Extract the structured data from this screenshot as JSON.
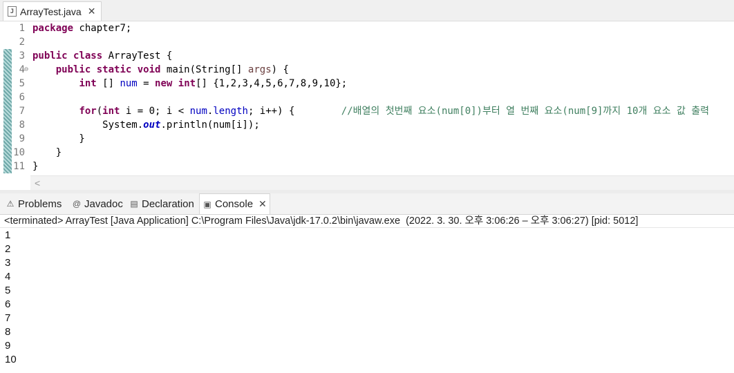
{
  "editor_tab": {
    "filename": "ArrayTest.java"
  },
  "code_lines": [
    {
      "n": "1",
      "segs": [
        [
          "kw",
          "package"
        ],
        [
          "t",
          " chapter7;"
        ]
      ]
    },
    {
      "n": "2",
      "segs": []
    },
    {
      "n": "3",
      "segs": [
        [
          "kw",
          "public"
        ],
        [
          "t",
          " "
        ],
        [
          "kw",
          "class"
        ],
        [
          "t",
          " ArrayTest {"
        ]
      ]
    },
    {
      "n": "4",
      "segs": [
        [
          "t",
          "    "
        ],
        [
          "kw",
          "public"
        ],
        [
          "t",
          " "
        ],
        [
          "kw",
          "static"
        ],
        [
          "t",
          " "
        ],
        [
          "kw",
          "void"
        ],
        [
          "t",
          " main(String[] "
        ],
        [
          "arg",
          "args"
        ],
        [
          "t",
          ") {"
        ]
      ]
    },
    {
      "n": "5",
      "segs": [
        [
          "t",
          "        "
        ],
        [
          "kw",
          "int"
        ],
        [
          "t",
          " [] "
        ],
        [
          "fld",
          "num"
        ],
        [
          "t",
          " = "
        ],
        [
          "kw",
          "new"
        ],
        [
          "t",
          " "
        ],
        [
          "kw",
          "int"
        ],
        [
          "t",
          "[] {1,2,3,4,5,6,7,8,9,10};"
        ]
      ]
    },
    {
      "n": "6",
      "segs": []
    },
    {
      "n": "7",
      "segs": [
        [
          "t",
          "        "
        ],
        [
          "kw",
          "for"
        ],
        [
          "t",
          "("
        ],
        [
          "kw",
          "int"
        ],
        [
          "t",
          " i = 0; i < "
        ],
        [
          "fld",
          "num"
        ],
        [
          "t",
          "."
        ],
        [
          "fld",
          "length"
        ],
        [
          "t",
          "; i++) {        "
        ],
        [
          "cmt",
          "//배열의 첫번째 요소(num[0])부터 열 번째 요소(num[9]까지 10개 요소 값 출력"
        ]
      ]
    },
    {
      "n": "8",
      "segs": [
        [
          "t",
          "            System."
        ],
        [
          "stat",
          "out"
        ],
        [
          "t",
          ".println(num[i]);"
        ]
      ]
    },
    {
      "n": "9",
      "segs": [
        [
          "t",
          "        }"
        ]
      ]
    },
    {
      "n": "10",
      "segs": [
        [
          "t",
          "    }"
        ]
      ]
    },
    {
      "n": "11",
      "segs": [
        [
          "t",
          "}"
        ]
      ]
    }
  ],
  "view_tabs": {
    "problems": "Problems",
    "javadoc": "Javadoc",
    "declaration": "Declaration",
    "console": "Console"
  },
  "console_status": "<terminated> ArrayTest [Java Application] C:\\Program Files\\Java\\jdk-17.0.2\\bin\\javaw.exe  (2022. 3. 30. 오후 3:06:26 – 오후 3:06:27) [pid: 5012]",
  "console_output": [
    "1",
    "2",
    "3",
    "4",
    "5",
    "6",
    "7",
    "8",
    "9",
    "10"
  ]
}
